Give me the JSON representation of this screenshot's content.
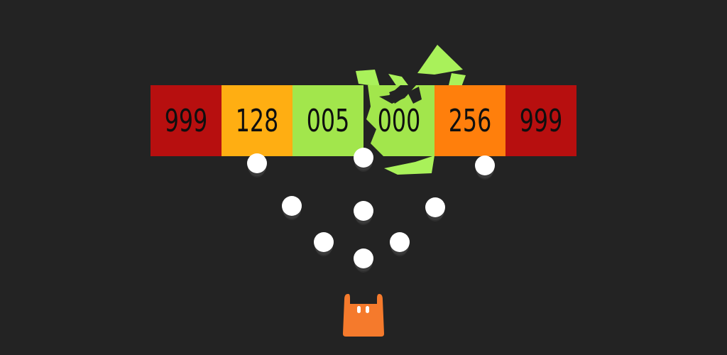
{
  "game": {
    "blocks": [
      {
        "value": "999",
        "color": "#b70f0f"
      },
      {
        "value": "128",
        "color": "#ffae12"
      },
      {
        "value": "005",
        "color": "#a2e64c"
      },
      {
        "value": "000",
        "color": "#a2e64c"
      },
      {
        "value": "256",
        "color": "#ff7f0c"
      },
      {
        "value": "999",
        "color": "#b70f0f"
      }
    ],
    "ball_count": 10,
    "ball_color": "#ffffff",
    "shard_color": "#a9f15a",
    "cannon_color": "#f57a2c",
    "background_color": "#232323"
  }
}
